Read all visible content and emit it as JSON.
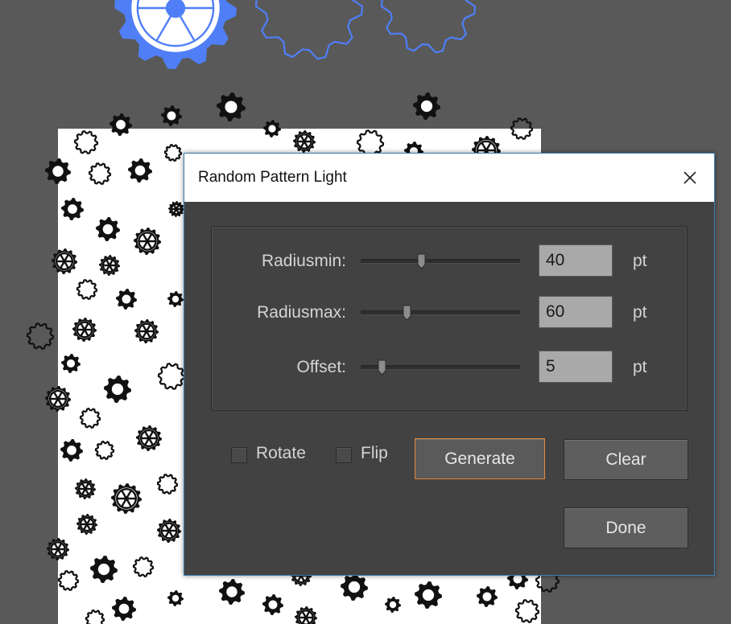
{
  "dialog": {
    "title": "Random Pattern Light",
    "close_icon": "close-x-icon",
    "sliders": [
      {
        "label": "Radiusmin:",
        "value": "40",
        "unit": "pt",
        "position": 0.38
      },
      {
        "label": "Radiusmax:",
        "value": "60",
        "unit": "pt",
        "position": 0.29
      },
      {
        "label": "Offset:",
        "value": "5",
        "unit": "pt",
        "position": 0.13
      }
    ],
    "options": [
      {
        "label": "Rotate",
        "checked": false
      },
      {
        "label": "Flip",
        "checked": false
      }
    ],
    "buttons": {
      "generate": "Generate",
      "clear": "Clear",
      "done": "Done"
    }
  },
  "colors": {
    "workspace": "#595959",
    "dialog_bg": "#424242",
    "dialog_border": "#3c7fb1",
    "focus_accent": "#e2873c",
    "selection_blue": "#4f7ef7",
    "gear_fill": "#111111"
  }
}
